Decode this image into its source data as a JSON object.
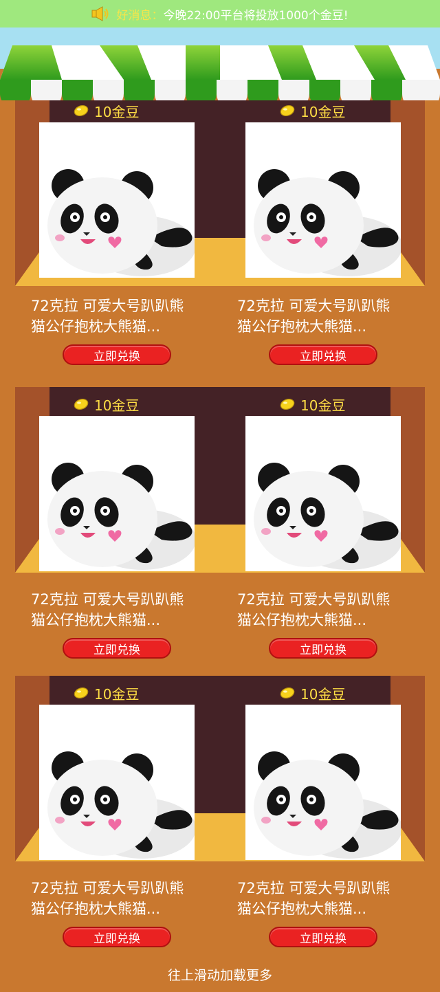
{
  "notice": {
    "label": "好消息：",
    "message": "今晚22:00平台将投放1000个金豆!"
  },
  "colors": {
    "notice_bg": "#9fe87e",
    "awning_green": "#4caf23",
    "wall": "#c9782f",
    "back_wall": "#442226",
    "floor": "#f1b840",
    "price_text": "#ffde45",
    "button": "#ea2222"
  },
  "products": [
    {
      "price": "10金豆",
      "title_line1": "72克拉 可爱大号趴趴熊",
      "title_line2": "猫公仔抱枕大熊猫...",
      "button": "立即兑换"
    },
    {
      "price": "10金豆",
      "title_line1": "72克拉 可爱大号趴趴熊",
      "title_line2": "猫公仔抱枕大熊猫...",
      "button": "立即兑换"
    },
    {
      "price": "10金豆",
      "title_line1": "72克拉 可爱大号趴趴熊",
      "title_line2": "猫公仔抱枕大熊猫...",
      "button": "立即兑换"
    },
    {
      "price": "10金豆",
      "title_line1": "72克拉 可爱大号趴趴熊",
      "title_line2": "猫公仔抱枕大熊猫...",
      "button": "立即兑换"
    },
    {
      "price": "10金豆",
      "title_line1": "72克拉 可爱大号趴趴熊",
      "title_line2": "猫公仔抱枕大熊猫...",
      "button": "立即兑换"
    },
    {
      "price": "10金豆",
      "title_line1": "72克拉 可爱大号趴趴熊",
      "title_line2": "猫公仔抱枕大熊猫...",
      "button": "立即兑换"
    }
  ],
  "load_more": "往上滑动加载更多"
}
